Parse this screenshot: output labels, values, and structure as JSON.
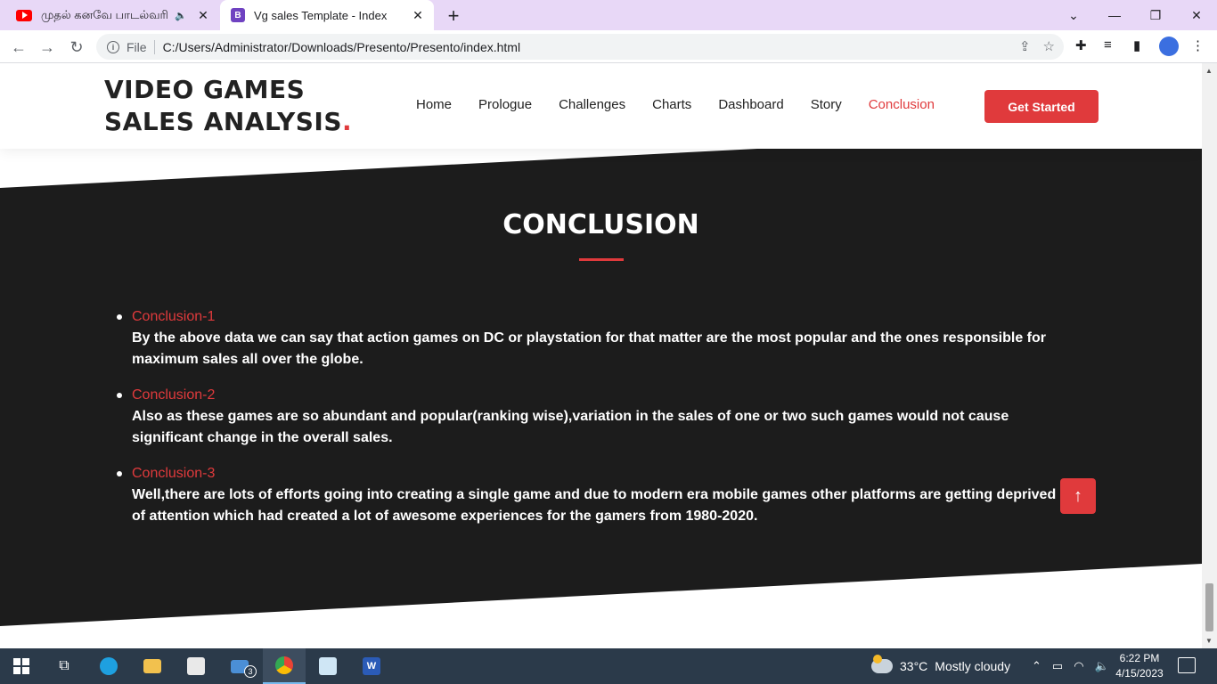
{
  "browser": {
    "tabs": [
      {
        "title": "முதல் கனவே பாடல்வரி",
        "favicon": "youtube-icon",
        "audio": true
      },
      {
        "title": "Vg sales Template - Index",
        "favicon": "bootstrap-icon",
        "active": true
      }
    ],
    "new_tab": "+",
    "address": {
      "scheme_label": "File",
      "url": "C:/Users/Administrator/Downloads/Presento/Presento/index.html"
    }
  },
  "site": {
    "logo_text": "VIDEO GAMES SALES ANALYSIS",
    "logo_dot": ".",
    "nav": [
      {
        "label": "Home"
      },
      {
        "label": "Prologue"
      },
      {
        "label": "Challenges"
      },
      {
        "label": "Charts"
      },
      {
        "label": "Dashboard"
      },
      {
        "label": "Story"
      },
      {
        "label": "Conclusion",
        "active": true
      }
    ],
    "cta": "Get Started",
    "colors": {
      "accent": "#e03a3c",
      "dark_section": "#1c1c1c"
    }
  },
  "section": {
    "title": "CONCLUSION",
    "items": [
      {
        "heading": "Conclusion-1",
        "body": "By the above data we can say that action games on DC or playstation for that matter are the most popular and the ones responsible for maximum sales all over the globe."
      },
      {
        "heading": "Conclusion-2",
        "body": "Also as these games are so abundant and popular(ranking wise),variation in the sales of one or two such games would not cause significant change in the overall sales."
      },
      {
        "heading": "Conclusion-3",
        "body": "Well,there are lots of efforts going into creating a single game and due to modern era mobile games other platforms are getting deprived of attention which had created a lot of awesome experiences for the gamers from 1980-2020."
      }
    ],
    "back_to_top": "↑"
  },
  "taskbar": {
    "weather": {
      "temp": "33°C",
      "condition": "Mostly cloudy"
    },
    "mail_badge": "3",
    "clock": {
      "time": "6:22 PM",
      "date": "4/15/2023"
    }
  }
}
